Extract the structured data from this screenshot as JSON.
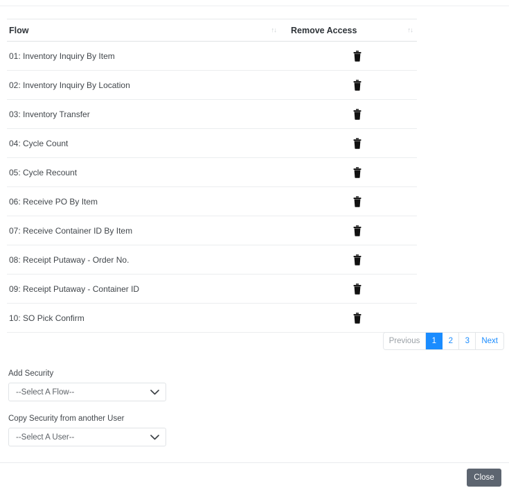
{
  "dialog": {
    "table": {
      "columns": [
        {
          "label": "Flow",
          "sort_icon": "sort-both-icon"
        },
        {
          "label": "Remove Access",
          "sort_icon": "sort-both-icon"
        }
      ],
      "sort_glyph": "↑↓",
      "rows": [
        {
          "flow": "01: Inventory Inquiry By Item",
          "action_icon": "trash-icon"
        },
        {
          "flow": "02: Inventory Inquiry By Location",
          "action_icon": "trash-icon"
        },
        {
          "flow": "03: Inventory Transfer",
          "action_icon": "trash-icon"
        },
        {
          "flow": "04: Cycle Count",
          "action_icon": "trash-icon"
        },
        {
          "flow": "05: Cycle Recount",
          "action_icon": "trash-icon"
        },
        {
          "flow": "06: Receive PO By Item",
          "action_icon": "trash-icon"
        },
        {
          "flow": "07: Receive Container ID By Item",
          "action_icon": "trash-icon"
        },
        {
          "flow": "08: Receipt Putaway - Order No.",
          "action_icon": "trash-icon"
        },
        {
          "flow": "09: Receipt Putaway - Container ID",
          "action_icon": "trash-icon"
        },
        {
          "flow": "10: SO Pick Confirm",
          "action_icon": "trash-icon"
        }
      ]
    },
    "pagination": {
      "previous_label": "Previous",
      "pages": [
        "1",
        "2",
        "3"
      ],
      "active_page": "1",
      "next_label": "Next"
    },
    "add_security": {
      "label": "Add Security",
      "selected": "--Select A Flow--",
      "chevron_icon": "chevron-down-icon"
    },
    "copy_security": {
      "label": "Copy Security from another User",
      "selected": "--Select A User--",
      "chevron_icon": "chevron-down-icon"
    },
    "footer": {
      "close_label": "Close"
    }
  },
  "colors": {
    "accent_blue": "#1a8cff",
    "close_button": "#5d6570",
    "text": "#41464b",
    "border": "#e7e9eb"
  }
}
